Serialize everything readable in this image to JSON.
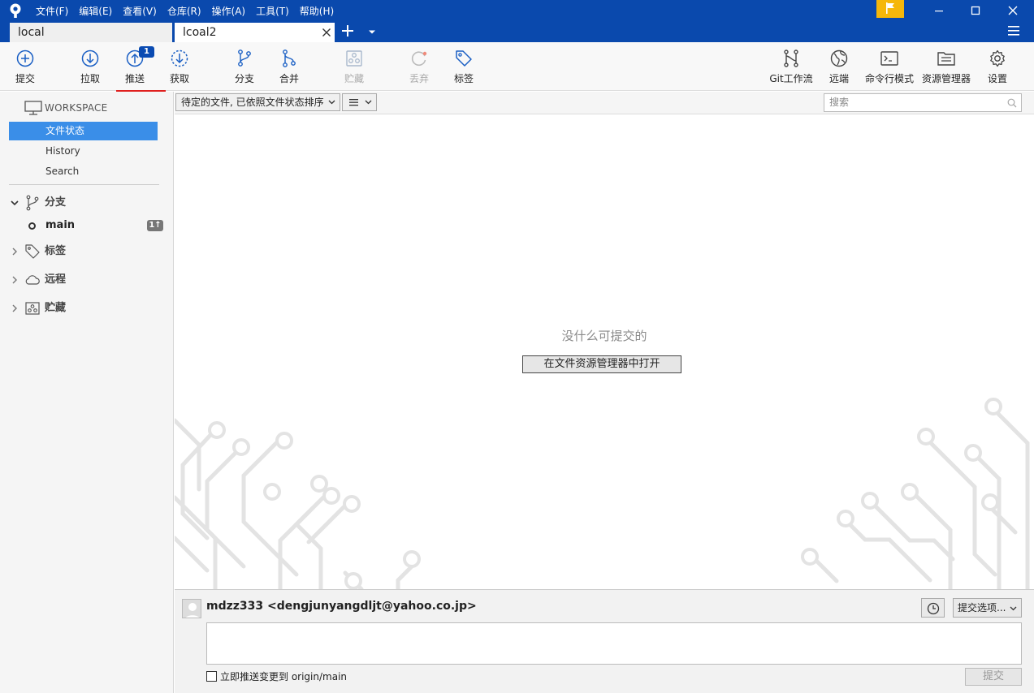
{
  "menu": [
    "文件(F)",
    "编辑(E)",
    "查看(V)",
    "仓库(R)",
    "操作(A)",
    "工具(T)",
    "帮助(H)"
  ],
  "tabs": [
    {
      "label": "local"
    },
    {
      "label": "lcoal2"
    }
  ],
  "toolbar": {
    "commit": "提交",
    "pull": "拉取",
    "push": "推送",
    "push_badge": "1",
    "fetch": "获取",
    "branch": "分支",
    "merge": "合并",
    "stash": "贮藏",
    "discard": "丢弃",
    "tag": "标签",
    "gitflow": "Git工作流",
    "remote": "远端",
    "terminal": "命令行模式",
    "explorer": "资源管理器",
    "settings": "设置"
  },
  "sidebar": {
    "workspace": "WORKSPACE",
    "items": [
      "文件状态",
      "History",
      "Search"
    ],
    "branches_label": "分支",
    "current_branch": "main",
    "branch_badge": "1↑",
    "tags_label": "标签",
    "remotes_label": "远程",
    "stashes_label": "贮藏"
  },
  "filter": {
    "sort_label": "待定的文件, 已依照文件状态排序",
    "search_placeholder": "搜索"
  },
  "content": {
    "empty_message": "没什么可提交的",
    "open_button": "在文件资源管理器中打开"
  },
  "commit": {
    "author": "mdzz333 <dengjunyangdljt@yahoo.co.jp>",
    "options_label": "提交选项...",
    "push_checkbox_label": "立即推送变更到 origin/main",
    "push_checked": false,
    "commit_button": "提交"
  },
  "colors": {
    "titlebar": "#0a49ad",
    "selected": "#3a8ee8",
    "accent": "#1a5fc4",
    "flag": "#f5b70a",
    "push_underline": "#e0201f"
  }
}
